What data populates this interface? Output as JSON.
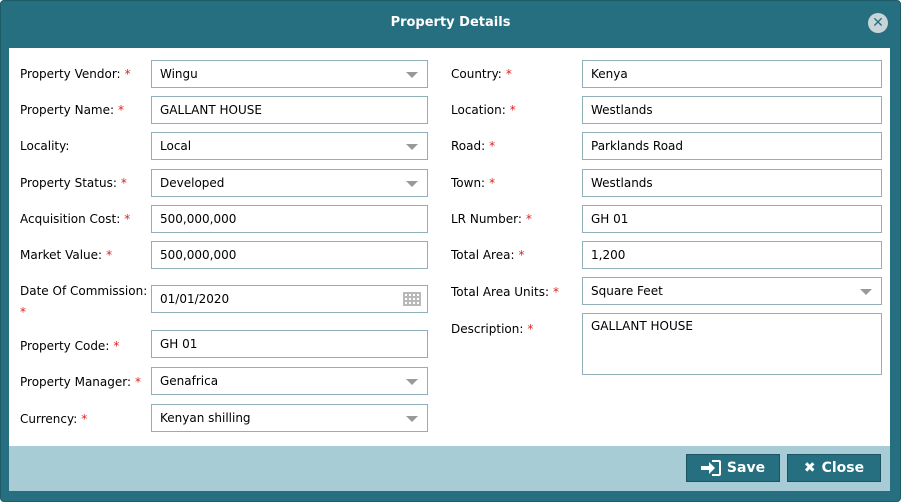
{
  "dialog": {
    "title": "Property Details",
    "close_icon": "close-circle-icon"
  },
  "form": {
    "left": [
      {
        "key": "vendor",
        "label": "Property Vendor:",
        "required": true,
        "type": "select",
        "value": "Wingu"
      },
      {
        "key": "name",
        "label": "Property Name:",
        "required": true,
        "type": "input",
        "value": "GALLANT HOUSE"
      },
      {
        "key": "locality",
        "label": "Locality:",
        "required": false,
        "type": "select",
        "value": "Local"
      },
      {
        "key": "status",
        "label": "Property Status:",
        "required": true,
        "type": "select",
        "value": "Developed"
      },
      {
        "key": "acq",
        "label": "Acquisition Cost:",
        "required": true,
        "type": "input",
        "value": "500,000,000"
      },
      {
        "key": "market",
        "label": "Market Value:",
        "required": true,
        "type": "input",
        "value": "500,000,000"
      },
      {
        "key": "doc",
        "label": "Date Of Commission:",
        "required": true,
        "type": "date",
        "value": "01/01/2020"
      },
      {
        "key": "code",
        "label": "Property Code:",
        "required": true,
        "type": "input",
        "value": "GH 01"
      },
      {
        "key": "manager",
        "label": "Property Manager:",
        "required": true,
        "type": "select",
        "value": "Genafrica"
      },
      {
        "key": "currency",
        "label": "Currency:",
        "required": true,
        "type": "select",
        "value": "Kenyan shilling"
      }
    ],
    "right": [
      {
        "key": "country",
        "label": "Country:",
        "required": true,
        "type": "input",
        "value": "Kenya"
      },
      {
        "key": "location",
        "label": "Location:",
        "required": true,
        "type": "input",
        "value": "Westlands"
      },
      {
        "key": "road",
        "label": "Road:",
        "required": true,
        "type": "input",
        "value": "Parklands Road"
      },
      {
        "key": "town",
        "label": "Town:",
        "required": true,
        "type": "input",
        "value": "Westlands"
      },
      {
        "key": "lr",
        "label": "LR Number:",
        "required": true,
        "type": "input",
        "value": "GH 01"
      },
      {
        "key": "area",
        "label": "Total Area:",
        "required": true,
        "type": "input",
        "value": "1,200"
      },
      {
        "key": "units",
        "label": "Total Area Units:",
        "required": true,
        "type": "select",
        "value": "Square Feet"
      },
      {
        "key": "desc",
        "label": "Description:",
        "required": true,
        "type": "textarea",
        "value": "GALLANT HOUSE"
      }
    ]
  },
  "footer": {
    "save_label": "Save",
    "close_label": "Close"
  },
  "colors": {
    "header": "#256f80",
    "footer": "#a8ccd5",
    "required": "#e02020"
  }
}
